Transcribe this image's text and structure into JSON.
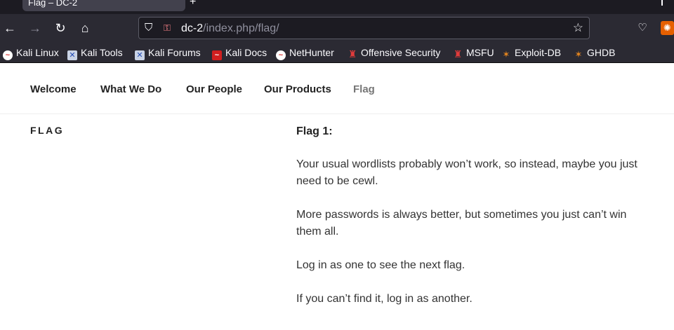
{
  "browser": {
    "tab_title": "Flag – DC-2",
    "new_tab_label": "+",
    "back_icon": "arrow-left",
    "forward_icon": "arrow-right",
    "reload_icon": "reload",
    "home_icon": "home",
    "url_host": "dc-2",
    "url_path": "/index.php/flag/",
    "bookmark_star_icon": "star-outline",
    "pocket_icon": "pocket",
    "extension_icon": "extension"
  },
  "bookmarks": [
    {
      "label": "Kali Linux",
      "icon": "kali-dragon"
    },
    {
      "label": "Kali Tools",
      "icon": "kali-tools"
    },
    {
      "label": "Kali Forums",
      "icon": "kali-tools"
    },
    {
      "label": "Kali Docs",
      "icon": "kali-docs"
    },
    {
      "label": "NetHunter",
      "icon": "kali-dragon"
    },
    {
      "label": "Offensive Security",
      "icon": "offsec"
    },
    {
      "label": "MSFU",
      "icon": "offsec"
    },
    {
      "label": "Exploit-DB",
      "icon": "exploit-db-bug"
    },
    {
      "label": "GHDB",
      "icon": "exploit-db-bug"
    }
  ],
  "site_nav": [
    "Welcome",
    "What We Do",
    "Our People",
    "Our Products",
    "Flag"
  ],
  "page": {
    "title": "FLAG",
    "heading": "Flag 1:",
    "paragraphs": [
      "Your usual wordlists probably won’t work, so instead, maybe you just need to be cewl.",
      "More passwords is always better, but sometimes you just can’t win them all.",
      "Log in as one to see the next flag.",
      "If you can’t find it, log in as another."
    ]
  }
}
